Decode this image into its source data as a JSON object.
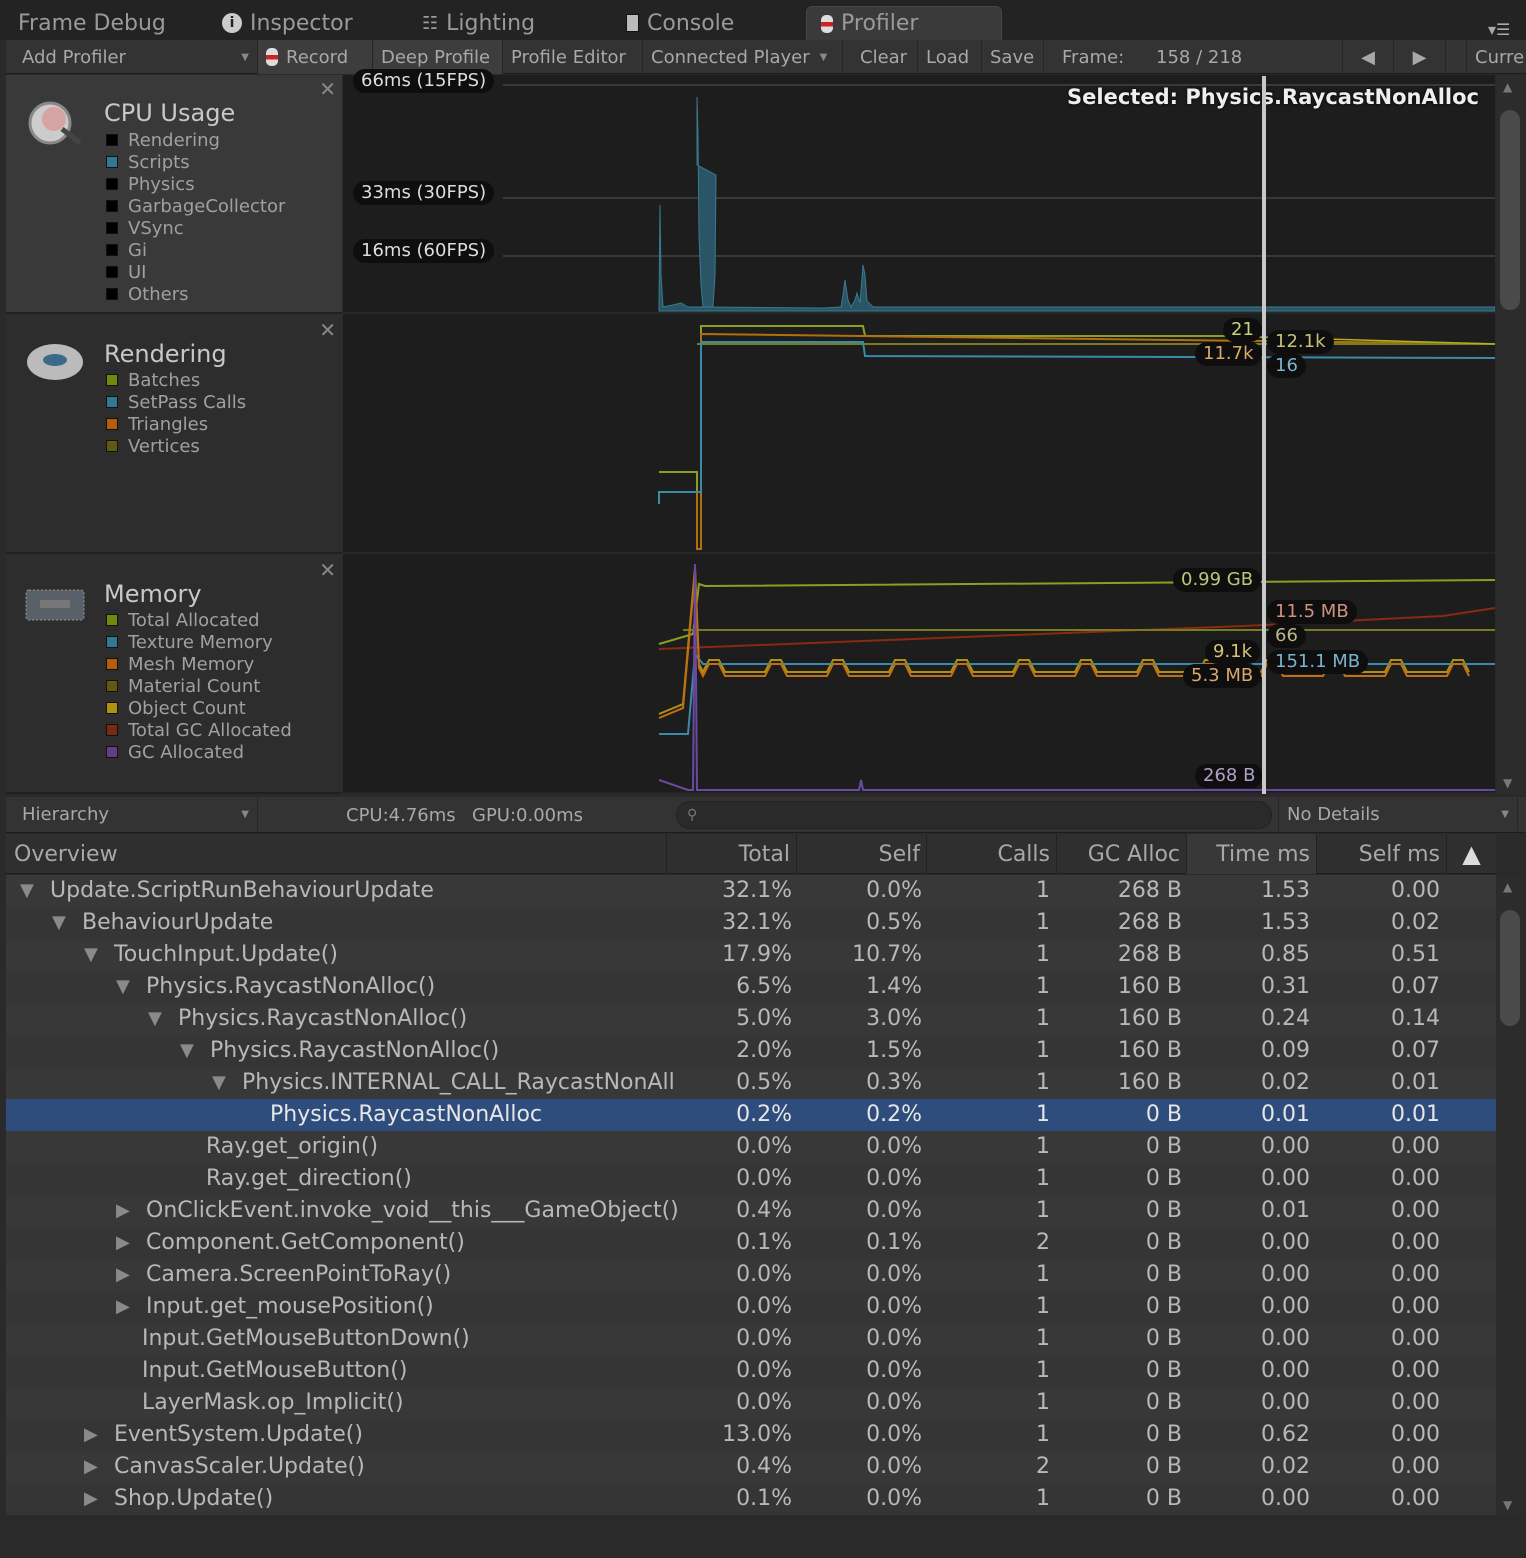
{
  "tabs": [
    {
      "label": "Frame Debug",
      "icon": ""
    },
    {
      "label": "Inspector",
      "icon": "info-icon"
    },
    {
      "label": "Lighting",
      "icon": "sliders-icon"
    },
    {
      "label": "Console",
      "icon": "console-icon"
    },
    {
      "label": "Profiler",
      "icon": "profiler-icon",
      "active": true
    }
  ],
  "toolbar": {
    "add_profiler": "Add Profiler",
    "record": "Record",
    "deep_profile": "Deep Profile",
    "profile_editor": "Profile Editor",
    "connected_player": "Connected Player",
    "clear": "Clear",
    "load": "Load",
    "save": "Save",
    "frame_label": "Frame:",
    "frame_value": "158 / 218",
    "current": "Curre"
  },
  "cpu": {
    "title": "CPU Usage",
    "legend": [
      {
        "label": "Rendering",
        "color": "#000000"
      },
      {
        "label": "Scripts",
        "color": "#2e7a96"
      },
      {
        "label": "Physics",
        "color": "#000000"
      },
      {
        "label": "GarbageCollector",
        "color": "#000000"
      },
      {
        "label": "VSync",
        "color": "#000000"
      },
      {
        "label": "Gi",
        "color": "#000000"
      },
      {
        "label": "UI",
        "color": "#000000"
      },
      {
        "label": "Others",
        "color": "#000000"
      }
    ],
    "gridlines": [
      "66ms (15FPS)",
      "33ms (30FPS)",
      "16ms (60FPS)"
    ],
    "selected": "Selected: Physics.RaycastNonAlloc"
  },
  "rendering": {
    "title": "Rendering",
    "legend": [
      {
        "label": "Batches",
        "color": "#6e8a10"
      },
      {
        "label": "SetPass Calls",
        "color": "#2e7a96"
      },
      {
        "label": "Triangles",
        "color": "#b0600c"
      },
      {
        "label": "Vertices",
        "color": "#5e5a10"
      }
    ],
    "values": [
      {
        "text": "21",
        "color": "#c8d27a"
      },
      {
        "text": "11.7k",
        "color": "#d8a86a"
      },
      {
        "text": "12.1k",
        "color": "#c8c07a"
      },
      {
        "text": "16",
        "color": "#7ab4cc"
      }
    ]
  },
  "memory": {
    "title": "Memory",
    "legend": [
      {
        "label": "Total Allocated",
        "color": "#6e8a10"
      },
      {
        "label": "Texture Memory",
        "color": "#2e7a96"
      },
      {
        "label": "Mesh Memory",
        "color": "#b0600c"
      },
      {
        "label": "Material Count",
        "color": "#5e5a10"
      },
      {
        "label": "Object Count",
        "color": "#b09010"
      },
      {
        "label": "Total GC Allocated",
        "color": "#7a2a10"
      },
      {
        "label": "GC Allocated",
        "color": "#5e3e8a"
      }
    ],
    "values": [
      {
        "text": "0.99 GB",
        "color": "#b8c87a"
      },
      {
        "text": "11.5 MB",
        "color": "#d09080"
      },
      {
        "text": "66",
        "color": "#b8b88a"
      },
      {
        "text": "9.1k",
        "color": "#d8c07a"
      },
      {
        "text": "151.1 MB",
        "color": "#7ab4cc"
      },
      {
        "text": "5.3 MB",
        "color": "#d8a86a"
      },
      {
        "text": "268 B",
        "color": "#b0a0c8"
      }
    ]
  },
  "hierarchy": {
    "mode": "Hierarchy",
    "cpu": "CPU:4.76ms",
    "gpu": "GPU:0.00ms",
    "search_placeholder": "",
    "details": "No Details"
  },
  "columns": [
    "Overview",
    "Total",
    "Self",
    "Calls",
    "GC Alloc",
    "Time ms",
    "Self ms"
  ],
  "sort_icon": "sort-ascending-icon",
  "rows": [
    {
      "level": 0,
      "toggle": "expanded",
      "name": "Update.ScriptRunBehaviourUpdate",
      "total": "32.1%",
      "self": "0.0%",
      "calls": "1",
      "gc": "268 B",
      "time": "1.53",
      "selfms": "0.00"
    },
    {
      "level": 1,
      "toggle": "expanded",
      "name": "BehaviourUpdate",
      "total": "32.1%",
      "self": "0.5%",
      "calls": "1",
      "gc": "268 B",
      "time": "1.53",
      "selfms": "0.02"
    },
    {
      "level": 2,
      "toggle": "expanded",
      "name": "TouchInput.Update()",
      "total": "17.9%",
      "self": "10.7%",
      "calls": "1",
      "gc": "268 B",
      "time": "0.85",
      "selfms": "0.51"
    },
    {
      "level": 3,
      "toggle": "expanded",
      "name": "Physics.RaycastNonAlloc()",
      "total": "6.5%",
      "self": "1.4%",
      "calls": "1",
      "gc": "160 B",
      "time": "0.31",
      "selfms": "0.07"
    },
    {
      "level": 4,
      "toggle": "expanded",
      "name": "Physics.RaycastNonAlloc()",
      "total": "5.0%",
      "self": "3.0%",
      "calls": "1",
      "gc": "160 B",
      "time": "0.24",
      "selfms": "0.14"
    },
    {
      "level": 5,
      "toggle": "expanded",
      "name": "Physics.RaycastNonAlloc()",
      "total": "2.0%",
      "self": "1.5%",
      "calls": "1",
      "gc": "160 B",
      "time": "0.09",
      "selfms": "0.07"
    },
    {
      "level": 6,
      "toggle": "expanded",
      "name": "Physics.INTERNAL_CALL_RaycastNonAll",
      "total": "0.5%",
      "self": "0.3%",
      "calls": "1",
      "gc": "160 B",
      "time": "0.02",
      "selfms": "0.01"
    },
    {
      "level": 7,
      "toggle": "none",
      "name": "Physics.RaycastNonAlloc",
      "total": "0.2%",
      "self": "0.2%",
      "calls": "1",
      "gc": "0 B",
      "time": "0.01",
      "selfms": "0.01",
      "selected": true
    },
    {
      "level": 5,
      "toggle": "none",
      "name": "Ray.get_origin()",
      "total": "0.0%",
      "self": "0.0%",
      "calls": "1",
      "gc": "0 B",
      "time": "0.00",
      "selfms": "0.00"
    },
    {
      "level": 5,
      "toggle": "none",
      "name": "Ray.get_direction()",
      "total": "0.0%",
      "self": "0.0%",
      "calls": "1",
      "gc": "0 B",
      "time": "0.00",
      "selfms": "0.00"
    },
    {
      "level": 3,
      "toggle": "collapsed",
      "name": "OnClickEvent.invoke_void__this___GameObject()",
      "total": "0.4%",
      "self": "0.0%",
      "calls": "1",
      "gc": "0 B",
      "time": "0.01",
      "selfms": "0.00"
    },
    {
      "level": 3,
      "toggle": "collapsed",
      "name": "Component.GetComponent()",
      "total": "0.1%",
      "self": "0.1%",
      "calls": "2",
      "gc": "0 B",
      "time": "0.00",
      "selfms": "0.00"
    },
    {
      "level": 3,
      "toggle": "collapsed",
      "name": "Camera.ScreenPointToRay()",
      "total": "0.0%",
      "self": "0.0%",
      "calls": "1",
      "gc": "0 B",
      "time": "0.00",
      "selfms": "0.00"
    },
    {
      "level": 3,
      "toggle": "collapsed",
      "name": "Input.get_mousePosition()",
      "total": "0.0%",
      "self": "0.0%",
      "calls": "1",
      "gc": "0 B",
      "time": "0.00",
      "selfms": "0.00"
    },
    {
      "level": 3,
      "toggle": "none",
      "name": "Input.GetMouseButtonDown()",
      "total": "0.0%",
      "self": "0.0%",
      "calls": "1",
      "gc": "0 B",
      "time": "0.00",
      "selfms": "0.00"
    },
    {
      "level": 3,
      "toggle": "none",
      "name": "Input.GetMouseButton()",
      "total": "0.0%",
      "self": "0.0%",
      "calls": "1",
      "gc": "0 B",
      "time": "0.00",
      "selfms": "0.00"
    },
    {
      "level": 3,
      "toggle": "none",
      "name": "LayerMask.op_Implicit()",
      "total": "0.0%",
      "self": "0.0%",
      "calls": "1",
      "gc": "0 B",
      "time": "0.00",
      "selfms": "0.00"
    },
    {
      "level": 2,
      "toggle": "collapsed",
      "name": "EventSystem.Update()",
      "total": "13.0%",
      "self": "0.0%",
      "calls": "1",
      "gc": "0 B",
      "time": "0.62",
      "selfms": "0.00"
    },
    {
      "level": 2,
      "toggle": "collapsed",
      "name": "CanvasScaler.Update()",
      "total": "0.4%",
      "self": "0.0%",
      "calls": "2",
      "gc": "0 B",
      "time": "0.02",
      "selfms": "0.00"
    },
    {
      "level": 2,
      "toggle": "collapsed",
      "name": "Shop.Update()",
      "total": "0.1%",
      "self": "0.0%",
      "calls": "1",
      "gc": "0 B",
      "time": "0.00",
      "selfms": "0.00"
    }
  ]
}
